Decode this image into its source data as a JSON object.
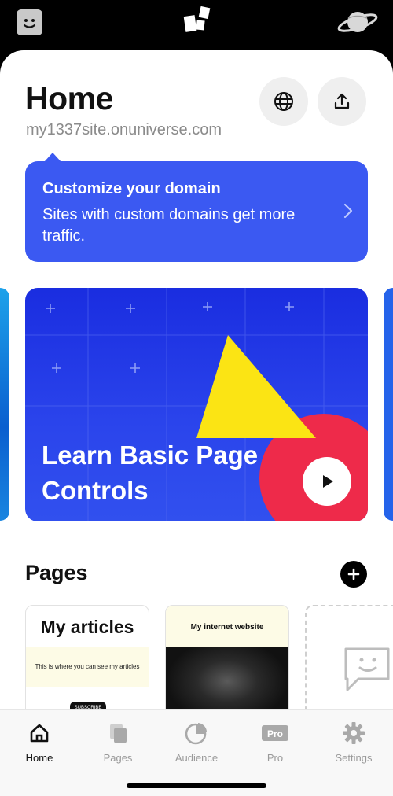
{
  "header": {
    "title": "Home",
    "domain": "my1337site.onuniverse.com"
  },
  "domain_callout": {
    "title": "Customize your domain",
    "body": "Sites with custom domains get more traffic."
  },
  "hero": {
    "title": "Learn Basic Page Controls"
  },
  "pages_section": {
    "heading": "Pages",
    "cards": [
      {
        "title": "My articles",
        "subtitle": "This is where you can see my articles",
        "button": "SUBSCRIBE"
      },
      {
        "title": "My internet website"
      }
    ]
  },
  "tabbar": {
    "items": [
      {
        "label": "Home",
        "icon": "home-icon",
        "active": true
      },
      {
        "label": "Pages",
        "icon": "pages-icon"
      },
      {
        "label": "Audience",
        "icon": "audience-icon"
      },
      {
        "label": "Pro",
        "icon": "pro-icon",
        "badge": "Pro"
      },
      {
        "label": "Settings",
        "icon": "gear-icon"
      }
    ]
  },
  "colors": {
    "accent": "#3b59f2",
    "hero_bg": "#2b45ec",
    "triangle": "#fbe414",
    "red_circle": "#ee2a4a"
  }
}
